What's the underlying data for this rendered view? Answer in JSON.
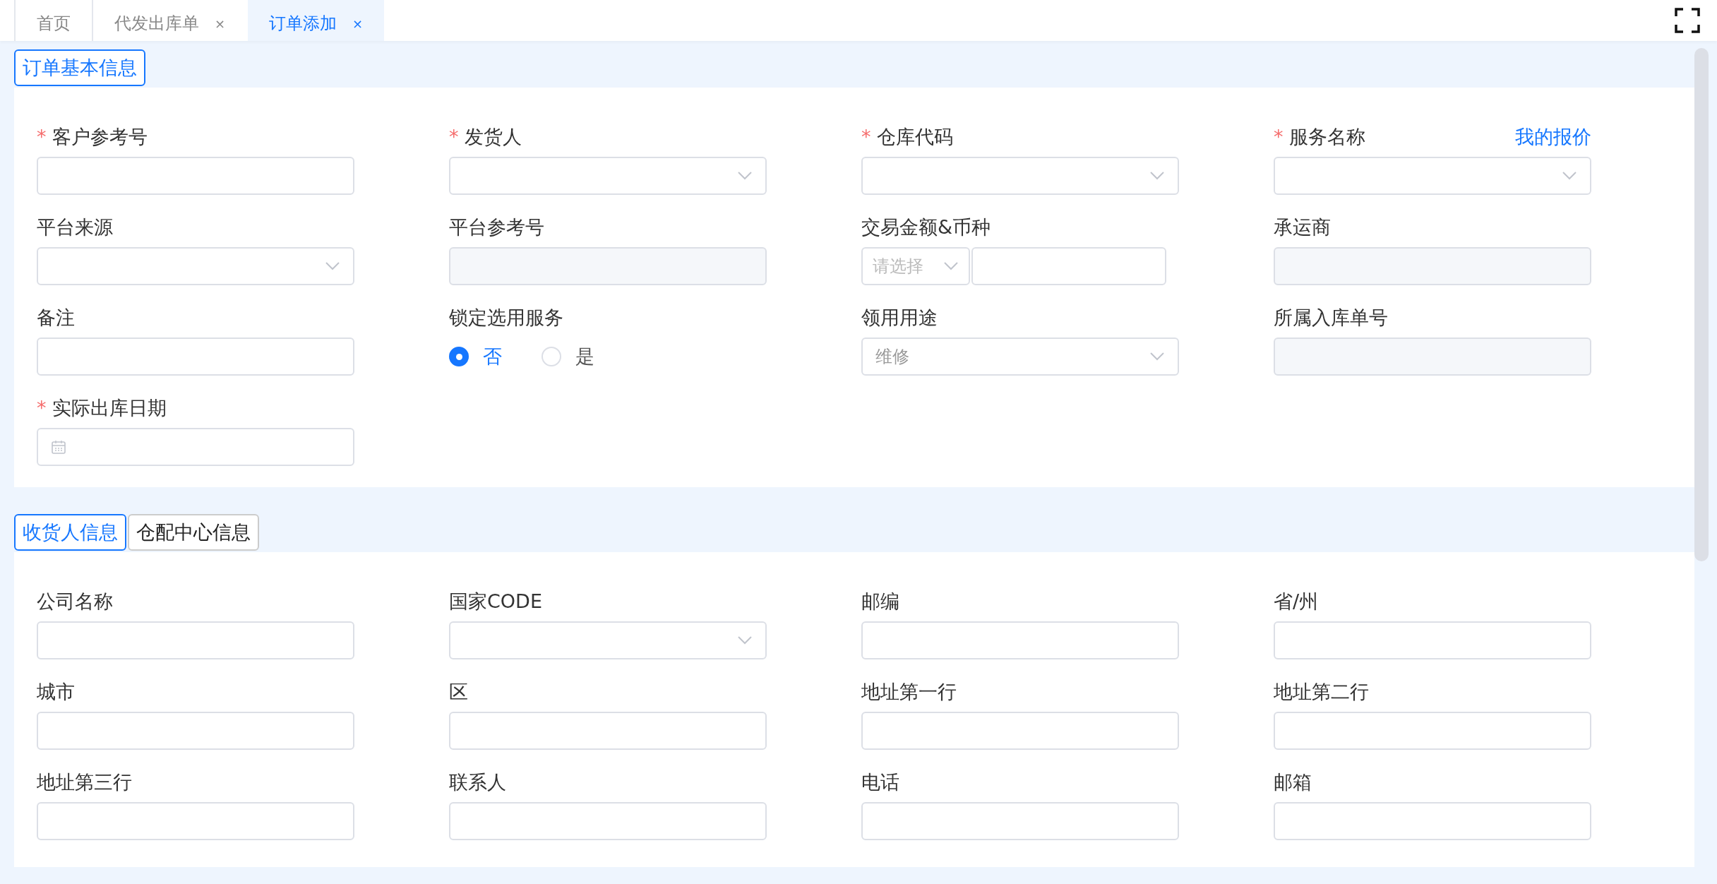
{
  "tabs": [
    {
      "label": "首页",
      "selected": false
    },
    {
      "label": "代发出库单",
      "close": "×",
      "selected": false
    },
    {
      "label": "订单添加",
      "close": "×",
      "selected": true
    }
  ],
  "sections": [
    {
      "tabs": [
        {
          "label": "订单基本信息",
          "selected": true
        }
      ],
      "fields": [
        {
          "kind": "text",
          "label": "客户参考号",
          "required_mark": "*"
        },
        {
          "kind": "select",
          "label": "发货人",
          "required_mark": "*"
        },
        {
          "kind": "select",
          "label": "仓库代码",
          "required_mark": "*"
        },
        {
          "kind": "select",
          "label": "服务名称",
          "required_mark": "*",
          "link": "我的报价"
        },
        {
          "kind": "select",
          "label": "平台来源"
        },
        {
          "kind": "readonly",
          "label": "平台参考号"
        },
        {
          "kind": "currency",
          "label": "交易金额&币种",
          "placeholder": "请选择"
        },
        {
          "kind": "readonly",
          "label": "承运商"
        },
        {
          "kind": "text",
          "label": "备注"
        },
        {
          "kind": "radio",
          "label": "锁定选用服务",
          "options": [
            {
              "label": "否",
              "selected": true
            },
            {
              "label": "是",
              "selected": false
            }
          ]
        },
        {
          "kind": "select",
          "label": "领用用途",
          "value": "维修"
        },
        {
          "kind": "readonly",
          "label": "所属入库单号"
        },
        {
          "kind": "date",
          "label": "实际出库日期",
          "required_mark": "*"
        }
      ]
    },
    {
      "tabs": [
        {
          "label": "收货人信息",
          "selected": true
        },
        {
          "label": "仓配中心信息",
          "selected": false
        }
      ],
      "fields": [
        {
          "kind": "text",
          "label": "公司名称"
        },
        {
          "kind": "select",
          "label": "国家CODE"
        },
        {
          "kind": "text",
          "label": "邮编"
        },
        {
          "kind": "text",
          "label": "省/州"
        },
        {
          "kind": "text",
          "label": "城市"
        },
        {
          "kind": "text",
          "label": "区"
        },
        {
          "kind": "text",
          "label": "地址第一行"
        },
        {
          "kind": "text",
          "label": "地址第二行"
        },
        {
          "kind": "text",
          "label": "地址第三行"
        },
        {
          "kind": "text",
          "label": "联系人"
        },
        {
          "kind": "text",
          "label": "电话"
        },
        {
          "kind": "text",
          "label": "邮箱"
        }
      ]
    }
  ]
}
